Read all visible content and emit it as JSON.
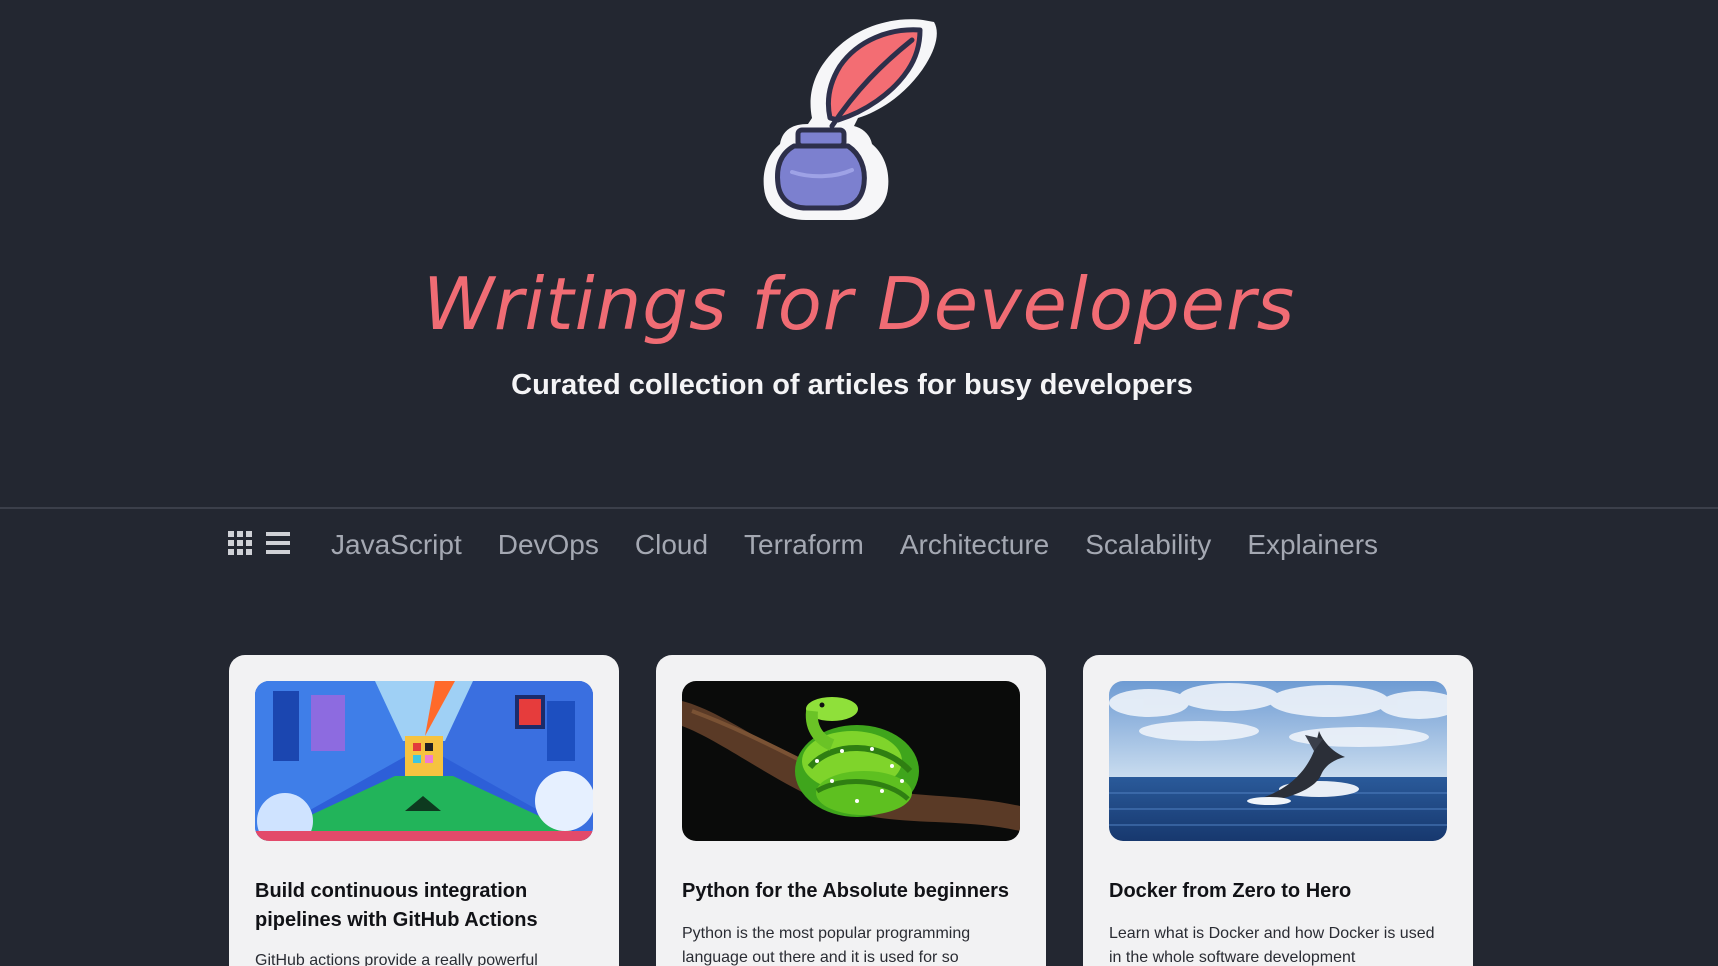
{
  "header": {
    "title": "Writings for Developers",
    "tagline": "Curated collection of articles for busy developers",
    "logo_icon": "quill-inkwell-logo"
  },
  "nav": {
    "view_icons": [
      "grid-view-icon",
      "list-view-icon"
    ],
    "items": [
      {
        "label": "JavaScript"
      },
      {
        "label": "DevOps"
      },
      {
        "label": "Cloud"
      },
      {
        "label": "Terraform"
      },
      {
        "label": "Architecture"
      },
      {
        "label": "Scalability"
      },
      {
        "label": "Explainers"
      }
    ]
  },
  "articles": [
    {
      "title": "Build continuous integration pipelines with GitHub Actions",
      "excerpt": "GitHub actions provide a really powerful",
      "image": "abstract-colorful-corridor-illustration"
    },
    {
      "title": "Python for the Absolute beginners",
      "excerpt": "Python is the most popular programming language out there and it is used for so",
      "image": "green-python-snake-on-branch"
    },
    {
      "title": "Docker from Zero to Hero",
      "excerpt": "Learn what is Docker and how Docker is used in the whole software development",
      "image": "whale-tail-in-ocean"
    }
  ],
  "colors": {
    "background": "#232731",
    "title_accent": "#f06c74",
    "nav_text": "#a4a8b2",
    "card_background": "#f2f2f3"
  }
}
